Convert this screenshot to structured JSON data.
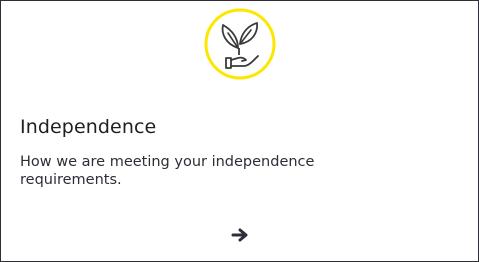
{
  "card": {
    "icon": "plant-in-hand-icon",
    "accent_color": "#ffe600",
    "title": "Independence",
    "description": "How we are meeting your independence requirements.",
    "link_icon": "arrow-right-icon"
  }
}
